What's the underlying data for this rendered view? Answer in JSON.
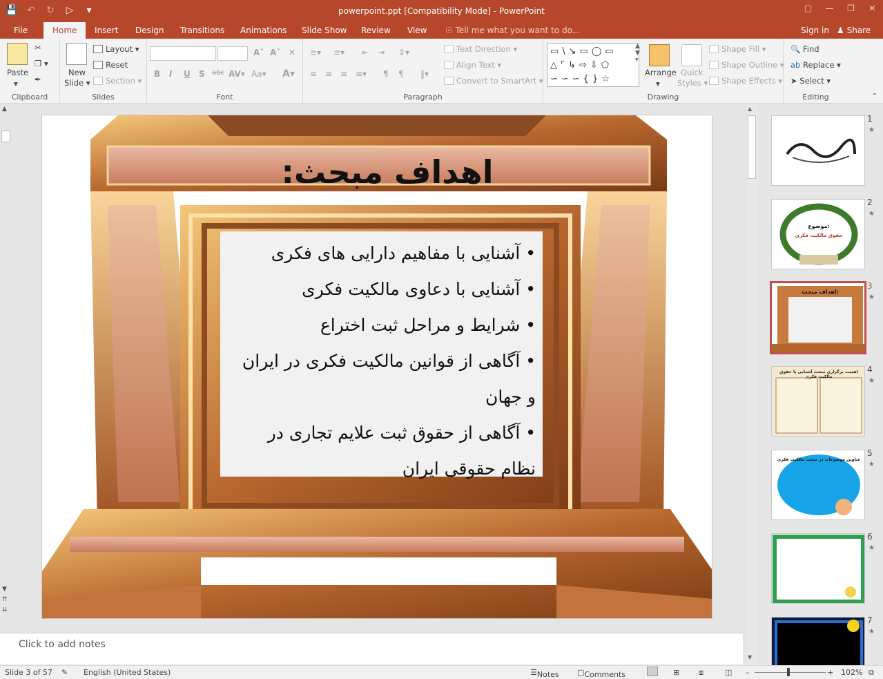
{
  "window": {
    "title": "powerpoint.ppt [Compatibility Mode] - PowerPoint",
    "accent": "#b7472a"
  },
  "tabs": [
    "File",
    "Home",
    "Insert",
    "Design",
    "Transitions",
    "Animations",
    "Slide Show",
    "Review",
    "View"
  ],
  "tell_me": "Tell me what you want to do...",
  "account": {
    "sign_in": "Sign in",
    "share": "Share"
  },
  "ribbon": {
    "clipboard": {
      "label": "Clipboard",
      "paste": "Paste"
    },
    "slides": {
      "label": "Slides",
      "new_slide_1": "New",
      "new_slide_2": "Slide",
      "layout": "Layout",
      "reset": "Reset",
      "section": "Section"
    },
    "font": {
      "label": "Font"
    },
    "paragraph": {
      "label": "Paragraph",
      "text_direction": "Text Direction",
      "align_text": "Align Text",
      "convert_smartart": "Convert to SmartArt"
    },
    "drawing": {
      "label": "Drawing",
      "arrange": "Arrange",
      "quick_styles_1": "Quick",
      "quick_styles_2": "Styles",
      "shape_fill": "Shape Fill",
      "shape_outline": "Shape Outline",
      "shape_effects": "Shape Effects"
    },
    "editing": {
      "label": "Editing",
      "find": "Find",
      "replace": "Replace",
      "select": "Select"
    }
  },
  "slide": {
    "title": "اهداف مبحث:",
    "bullets": [
      "آشنایی با مفاهیم دارایی های فکری",
      "آشنایی با دعاوی مالکیت فکری",
      "شرایط و مراحل ثبت اختراع",
      "آگاهی از قوانین مالکیت فکری در ایران و جهان",
      "آگاهی از حقوق ثبت علایم تجاری در نظام حقوقی ایران"
    ]
  },
  "thumbnails": [
    {
      "num": "1"
    },
    {
      "num": "2",
      "line1": "موضوع:",
      "line2": "حقوق مالکیت فکری"
    },
    {
      "num": "3",
      "line1": "اهداف مبحث:"
    },
    {
      "num": "4",
      "line1": "اهمیت برگزاری مبحث آشنایی با حقوق مالکیت فکری"
    },
    {
      "num": "5",
      "line1": "عناوین موضوعات در مبحث مالکیت فکری"
    },
    {
      "num": "6"
    },
    {
      "num": "7"
    }
  ],
  "notes": {
    "placeholder": "Click to add notes"
  },
  "status": {
    "slide_info": "Slide 3 of 57",
    "language": "English (United States)",
    "notes": "Notes",
    "comments": "Comments",
    "zoom": "102%"
  }
}
